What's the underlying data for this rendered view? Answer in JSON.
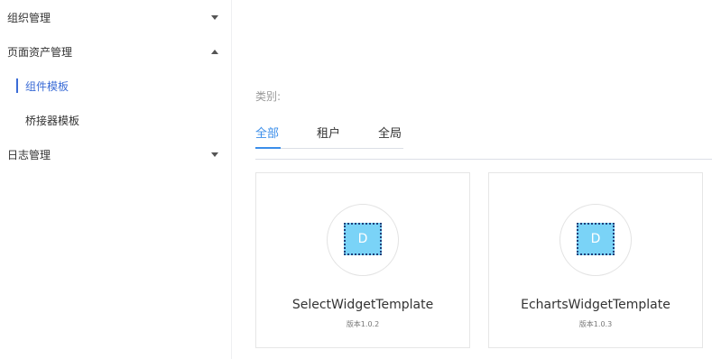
{
  "sidebar": {
    "items": [
      {
        "label": "组织管理",
        "expanded": false
      },
      {
        "label": "页面资产管理",
        "expanded": true
      },
      {
        "label": "组件模板",
        "active": true
      },
      {
        "label": "桥接器模板"
      },
      {
        "label": "日志管理",
        "expanded": false
      }
    ]
  },
  "main": {
    "category_label": "类别:",
    "tabs": [
      {
        "label": "全部",
        "active": true
      },
      {
        "label": "租户"
      },
      {
        "label": "全局"
      }
    ],
    "cards": [
      {
        "logo_letter": "D",
        "name": "SelectWidgetTemplate",
        "version": "版本1.0.2"
      },
      {
        "logo_letter": "D",
        "name": "EchartsWidgetTemplate",
        "version": "版本1.0.3"
      }
    ]
  },
  "colors": {
    "accent": "#3b8eea",
    "active_menu": "#3b6cd6",
    "logo_fill": "#7ad3f7"
  }
}
